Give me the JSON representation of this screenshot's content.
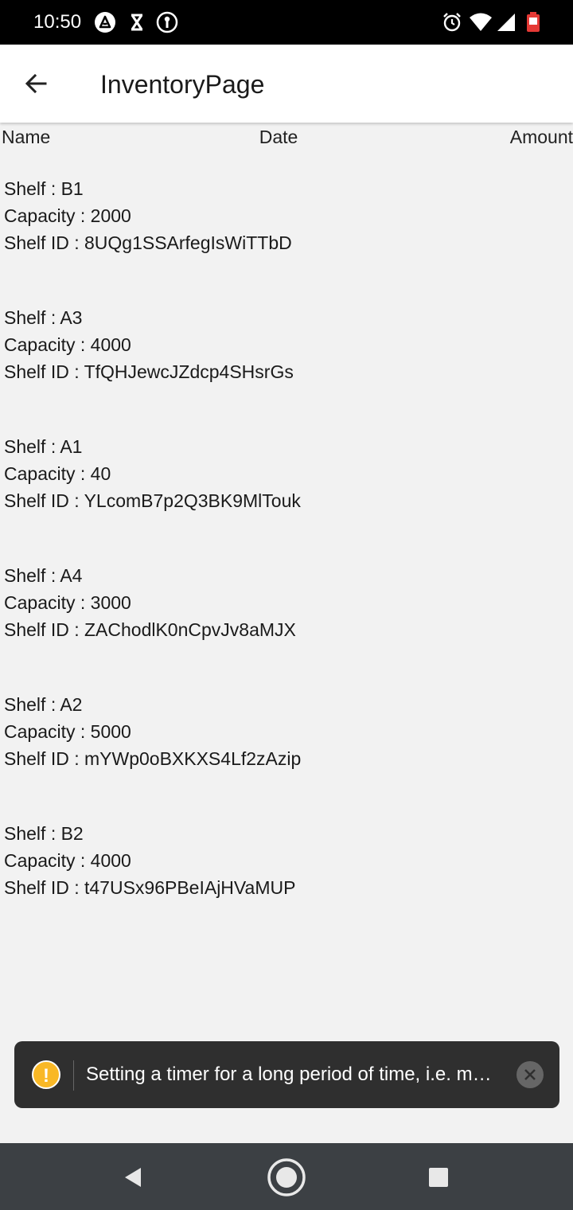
{
  "status_bar": {
    "time": "10:50",
    "left_icons": [
      "a-icon",
      "hourglass-icon",
      "key-icon"
    ],
    "right_icons": [
      "alarm-icon",
      "wifi-icon",
      "signal-icon",
      "battery-icon"
    ]
  },
  "app_bar": {
    "back_icon": "arrow-left-icon",
    "title": "InventoryPage"
  },
  "table_header": {
    "name": "Name",
    "date": "Date",
    "amount": "Amount"
  },
  "shelves": [
    {
      "shelf": "Shelf : B1",
      "capacity": "Capacity : 2000",
      "id": "Shelf ID : 8UQg1SSArfegIsWiTTbD"
    },
    {
      "shelf": "Shelf : A3",
      "capacity": "Capacity : 4000",
      "id": "Shelf ID : TfQHJewcJZdcp4SHsrGs"
    },
    {
      "shelf": "Shelf : A1",
      "capacity": "Capacity : 40",
      "id": "Shelf ID : YLcomB7p2Q3BK9MlTouk"
    },
    {
      "shelf": "Shelf : A4",
      "capacity": "Capacity : 3000",
      "id": "Shelf ID : ZAChodlK0nCpvJv8aMJX"
    },
    {
      "shelf": "Shelf : A2",
      "capacity": "Capacity : 5000",
      "id": "Shelf ID : mYWp0oBXKXS4Lf2zAzip"
    },
    {
      "shelf": "Shelf : B2",
      "capacity": "Capacity : 4000",
      "id": "Shelf ID : t47USx96PBeIAjHVaMUP"
    }
  ],
  "toast": {
    "icon": "warning-icon",
    "icon_glyph": "!",
    "message": "Setting a timer for a long period of time, i.e. multiple minutes",
    "close_icon": "close-icon"
  },
  "nav_bar": {
    "back": "back-triangle-icon",
    "home": "home-circle-icon",
    "recents": "recents-square-icon"
  },
  "colors": {
    "background": "#f2f2f2",
    "app_bar": "#ffffff",
    "status_bar": "#000000",
    "toast": "#2f2f2f",
    "warning": "#f9b826",
    "nav_bar": "#3c4044",
    "battery": "#e53935"
  }
}
